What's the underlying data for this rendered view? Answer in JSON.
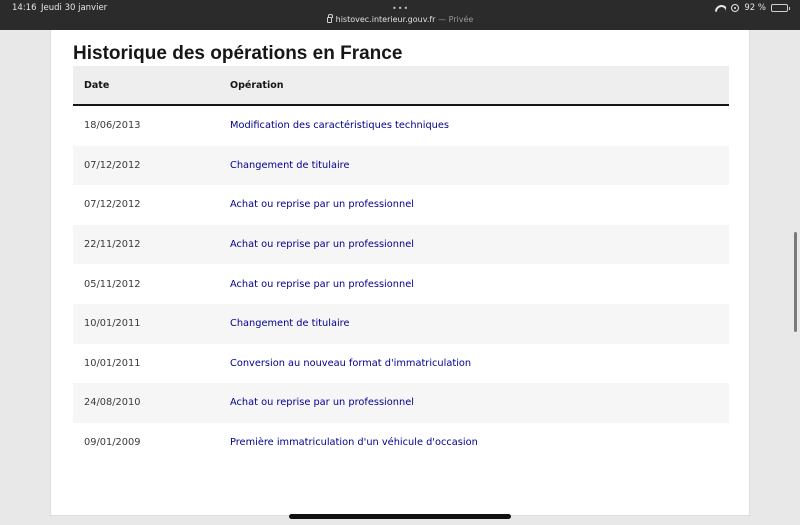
{
  "status_bar": {
    "time": "14:16",
    "date": "Jeudi 30 janvier",
    "url": "histovec.interieur.gouv.fr",
    "private_label": "— Privée",
    "battery": "92 %",
    "battery_fraction": 0.92
  },
  "page": {
    "title": "Historique des opérations en France",
    "table": {
      "headers": {
        "date": "Date",
        "operation": "Opération"
      },
      "rows": [
        {
          "date": "18/06/2013",
          "operation": "Modification des caractéristiques techniques"
        },
        {
          "date": "07/12/2012",
          "operation": "Changement de titulaire"
        },
        {
          "date": "07/12/2012",
          "operation": "Achat ou reprise par un professionnel"
        },
        {
          "date": "22/11/2012",
          "operation": "Achat ou reprise par un professionnel"
        },
        {
          "date": "05/11/2012",
          "operation": "Achat ou reprise par un professionnel"
        },
        {
          "date": "10/01/2011",
          "operation": "Changement de titulaire"
        },
        {
          "date": "10/01/2011",
          "operation": "Conversion au nouveau format d'immatriculation"
        },
        {
          "date": "24/08/2010",
          "operation": "Achat ou reprise par un professionnel"
        },
        {
          "date": "09/01/2009",
          "operation": "Première immatriculation d'un véhicule d'occasion"
        }
      ]
    }
  },
  "colors": {
    "link": "#000091",
    "header_bg": "#eeeeee",
    "row_alt_bg": "#f6f6f6",
    "status_bar_bg": "#2b2b2b"
  }
}
